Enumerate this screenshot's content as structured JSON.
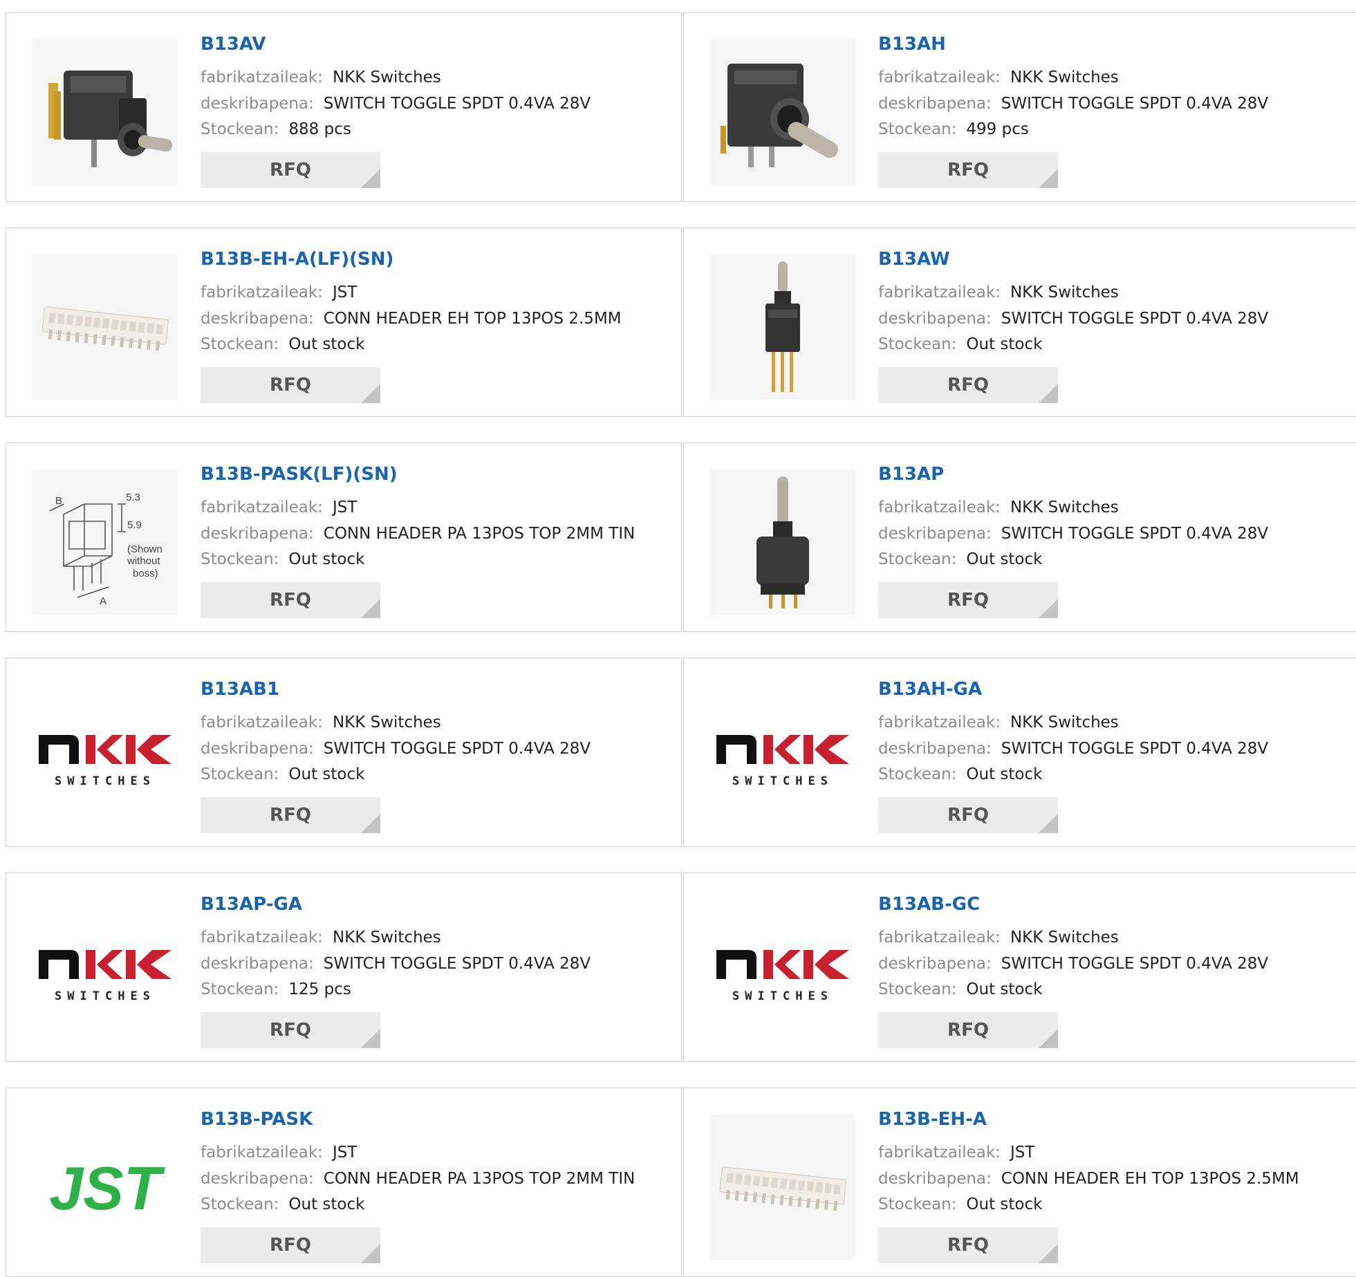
{
  "labels": {
    "manufacturer": "fabrikatzaileak:",
    "description": "deskribapena:",
    "stock": "Stockean:",
    "rfq": "RFQ"
  },
  "colors": {
    "title_link": "#1c63ad",
    "jst_green": "#2fb14a",
    "rfq_bg": "#ebebeb"
  },
  "products": [
    {
      "part": "B13AV",
      "manufacturer": "NKK Switches",
      "description": "SWITCH TOGGLE SPDT 0.4VA 28V",
      "stock": "888 pcs",
      "image": "toggle-switch-right-angle-photo"
    },
    {
      "part": "B13AH",
      "manufacturer": "NKK Switches",
      "description": "SWITCH TOGGLE SPDT 0.4VA 28V",
      "stock": "499 pcs",
      "image": "toggle-switch-horizontal-photo"
    },
    {
      "part": "B13B-EH-A(LF)(SN)",
      "manufacturer": "JST",
      "description": "CONN HEADER EH TOP 13POS 2.5MM",
      "stock": "Out stock",
      "image": "connector-header-photo"
    },
    {
      "part": "B13AW",
      "manufacturer": "NKK Switches",
      "description": "SWITCH TOGGLE SPDT 0.4VA 28V",
      "stock": "Out stock",
      "image": "toggle-switch-vertical-photo"
    },
    {
      "part": "B13B-PASK(LF)(SN)",
      "manufacturer": "JST",
      "description": "CONN HEADER PA 13POS TOP 2MM TIN",
      "stock": "Out stock",
      "image": "connector-drawing",
      "drawing_labels": [
        "B",
        "5.3",
        "5.9",
        "(Shown",
        "without",
        "boss)",
        "A"
      ]
    },
    {
      "part": "B13AP",
      "manufacturer": "NKK Switches",
      "description": "SWITCH TOGGLE SPDT 0.4VA 28V",
      "stock": "Out stock",
      "image": "toggle-switch-pcb-photo"
    },
    {
      "part": "B13AB1",
      "manufacturer": "NKK Switches",
      "description": "SWITCH TOGGLE SPDT 0.4VA 28V",
      "stock": "Out stock",
      "image": "nkk-logo"
    },
    {
      "part": "B13AH-GA",
      "manufacturer": "NKK Switches",
      "description": "SWITCH TOGGLE SPDT 0.4VA 28V",
      "stock": "Out stock",
      "image": "nkk-logo"
    },
    {
      "part": "B13AP-GA",
      "manufacturer": "NKK Switches",
      "description": "SWITCH TOGGLE SPDT 0.4VA 28V",
      "stock": "125 pcs",
      "image": "nkk-logo"
    },
    {
      "part": "B13AB-GC",
      "manufacturer": "NKK Switches",
      "description": "SWITCH TOGGLE SPDT 0.4VA 28V",
      "stock": "Out stock",
      "image": "nkk-logo"
    },
    {
      "part": "B13B-PASK",
      "manufacturer": "JST",
      "description": "CONN HEADER PA 13POS TOP 2MM TIN",
      "stock": "Out stock",
      "image": "jst-logo"
    },
    {
      "part": "B13B-EH-A",
      "manufacturer": "JST",
      "description": "CONN HEADER EH TOP 13POS 2.5MM",
      "stock": "Out stock",
      "image": "connector-header-photo"
    }
  ],
  "logos": {
    "nkk": {
      "mark": "NKK",
      "sub": "SWITCHES"
    },
    "jst": {
      "mark": "JST"
    }
  }
}
